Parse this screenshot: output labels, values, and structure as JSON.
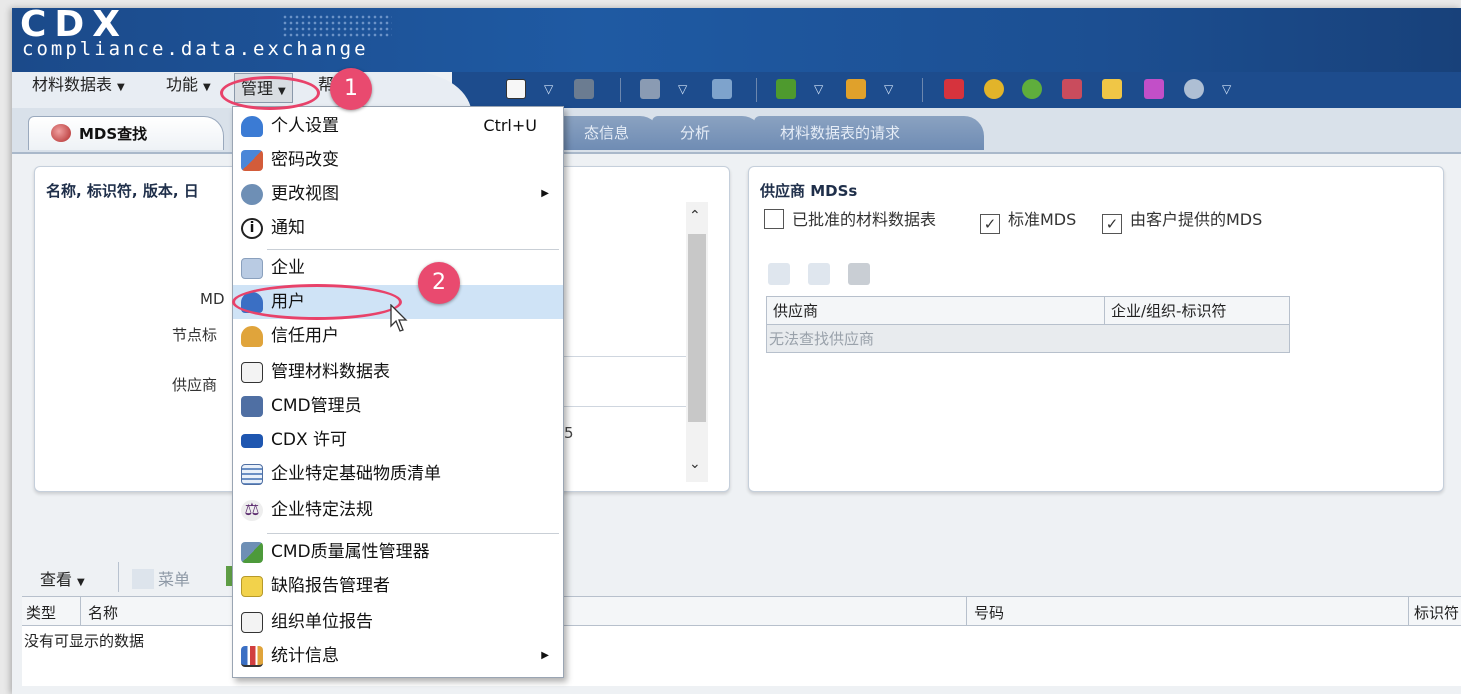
{
  "logo": {
    "main": "CDX",
    "sub": "compliance.data.exchange"
  },
  "menubar": [
    {
      "label": "材料数据表"
    },
    {
      "label": "功能"
    },
    {
      "label": "管理"
    },
    {
      "label": "帮助"
    }
  ],
  "tabs": [
    {
      "label": "MDS查找"
    },
    {
      "label": "态信息"
    },
    {
      "label": "分析"
    },
    {
      "label": "材料数据表的请求"
    }
  ],
  "left_panel": {
    "title": "名称, 标识符, 版本, 日",
    "labels": [
      "MD",
      "节点标",
      "供应商"
    ],
    "fragment": "5"
  },
  "right_panel": {
    "title": "供应商 MDSs",
    "checkboxes": [
      {
        "label": "已批准的材料数据表",
        "checked": false
      },
      {
        "label": "标准MDS",
        "checked": true
      },
      {
        "label": "由客户提供的MDS",
        "checked": true
      }
    ],
    "table": {
      "columns": [
        "供应商",
        "企业/组织-标识符"
      ],
      "empty_text": "无法查找供应商"
    }
  },
  "bottom": {
    "view_label": "查看",
    "menu_label": "菜单",
    "columns": [
      "类型",
      "名称",
      "号码",
      "标识符"
    ],
    "empty_text": "没有可显示的数据"
  },
  "dropdown": {
    "items": [
      {
        "label": "个人设置",
        "shortcut": "Ctrl+U",
        "icon": "person-icon",
        "color": "#3b7bd4"
      },
      {
        "label": "密码改变",
        "icon": "password-icon",
        "color": "#d35c3a"
      },
      {
        "label": "更改视图",
        "icon": "gear-icon",
        "color": "#6e8fb5",
        "submenu": true
      },
      {
        "label": "通知",
        "icon": "info-icon",
        "color": "#ffffff"
      },
      {
        "label": "企业",
        "icon": "home-icon",
        "color": "#b9cbe3"
      },
      {
        "label": "用户",
        "icon": "user-icon",
        "color": "#3a6fc4",
        "highlighted": true
      },
      {
        "label": "信任用户",
        "icon": "trusted-user-icon",
        "color": "#e0a43b"
      },
      {
        "label": "管理材料数据表",
        "icon": "document-icon",
        "color": "#f3f3f3"
      },
      {
        "label": "CMD管理员",
        "icon": "admin-icon",
        "color": "#4f6fa3"
      },
      {
        "label": "CDX 许可",
        "icon": "license-icon",
        "color": "#1e56b0"
      },
      {
        "label": "企业特定基础物质清单",
        "icon": "list-icon",
        "color": "#eaf1fa"
      },
      {
        "label": "企业特定法规",
        "icon": "gavel-icon",
        "color": "#5b2b6e"
      },
      {
        "label": "CMD质量属性管理器",
        "icon": "quality-icon",
        "color": "#4d9a3b"
      },
      {
        "label": "缺陷报告管理者",
        "icon": "report-icon",
        "color": "#f2d24b"
      },
      {
        "label": "组织单位报告",
        "icon": "org-report-icon",
        "color": "#f3f3f3"
      },
      {
        "label": "统计信息",
        "icon": "chart-icon",
        "color": "#3a6fc4",
        "submenu": true
      }
    ]
  },
  "annotations": {
    "step1": "1",
    "step2": "2"
  },
  "colors": {
    "header": "#1f5aa3",
    "accent": "#e94a6f",
    "highlight": "#cfe3f6"
  }
}
